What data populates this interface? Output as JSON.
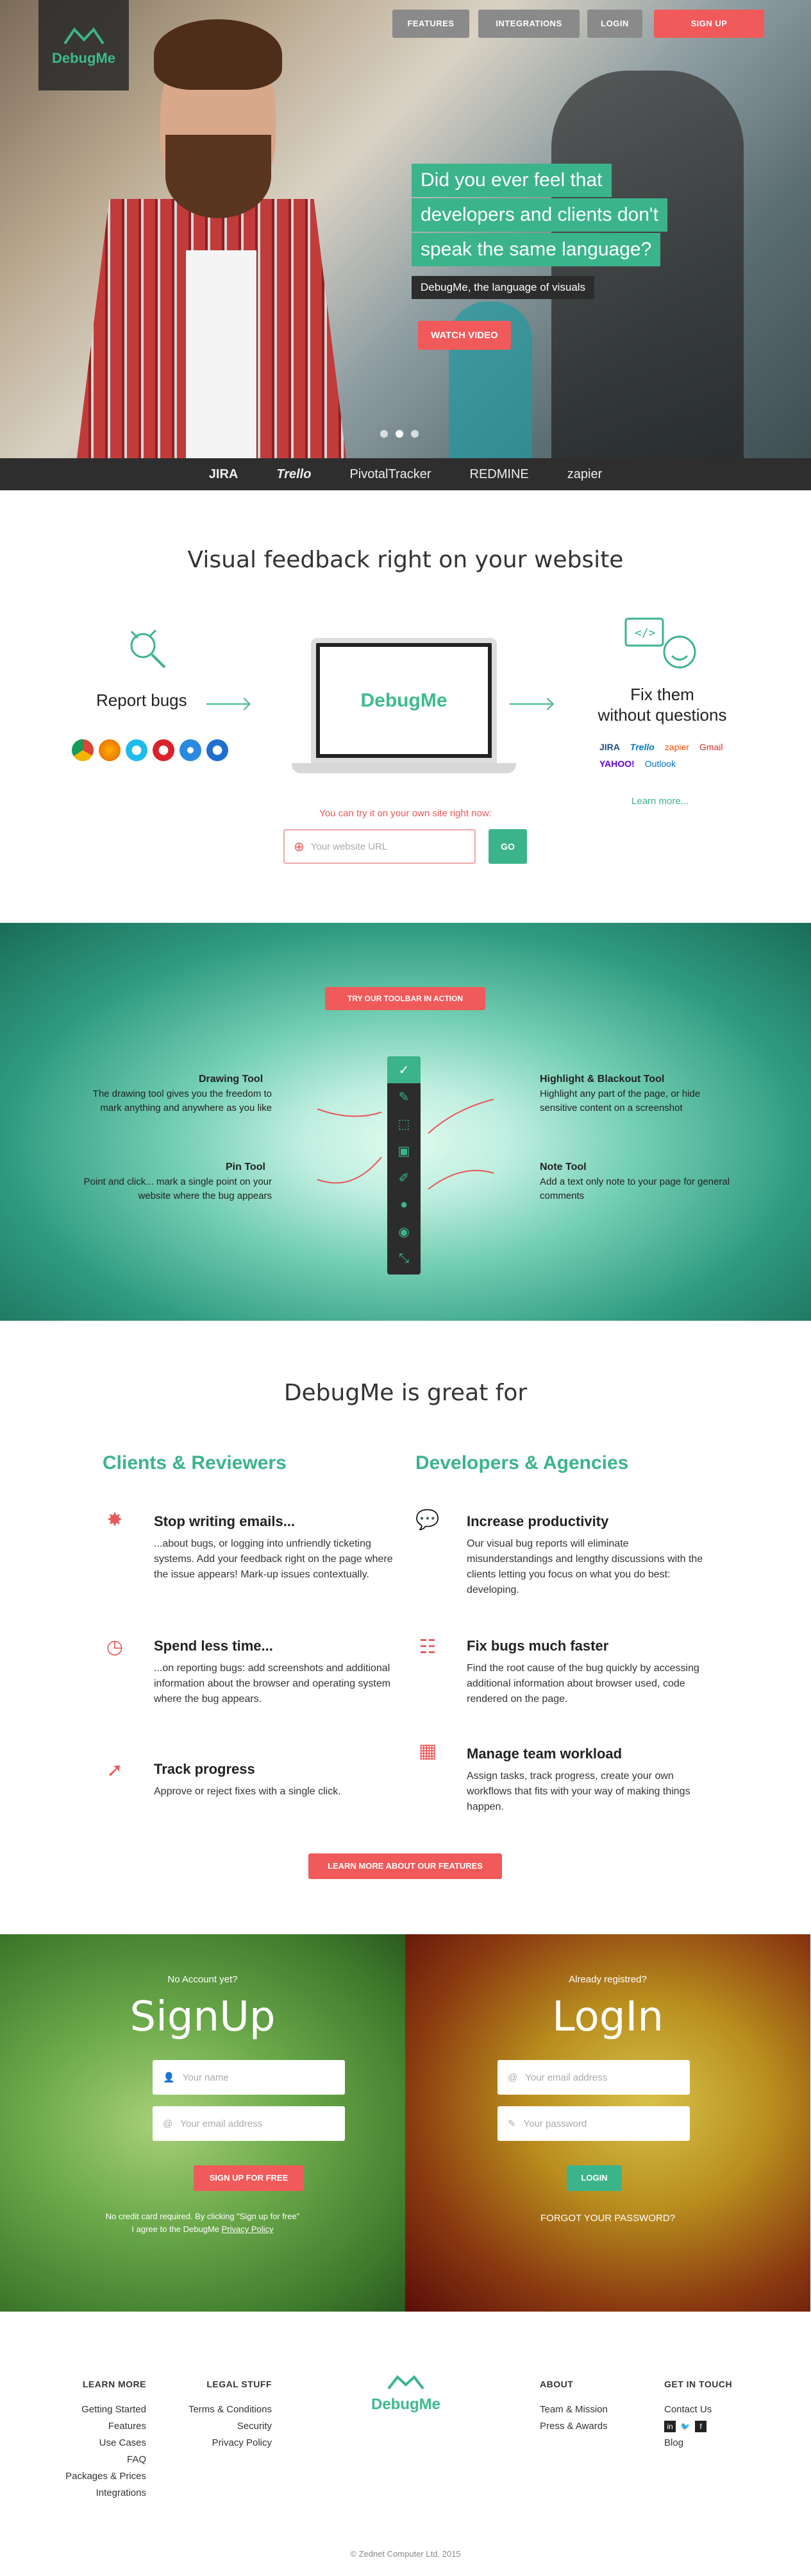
{
  "nav": {
    "logo": "DebugMe",
    "features": "FEATURES",
    "integrations": "INTEGRATIONS",
    "login": "LOGIN",
    "signup": "SIGN UP"
  },
  "hero": {
    "line1": "Did you ever feel that",
    "line2": "developers and clients don't",
    "line3": "speak the same language?",
    "subtitle": "DebugMe, the language of visuals",
    "watch_video": "WATCH VIDEO"
  },
  "partners": [
    "JIRA",
    "Trello",
    "PivotalTracker",
    "REDMINE",
    "zapier"
  ],
  "visual": {
    "title": "Visual feedback right on your website",
    "report_bugs": "Report bugs",
    "fix_line1": "Fix them",
    "fix_line2": "without questions",
    "tools": [
      "JIRA",
      "Trello",
      "zapier",
      "Gmail",
      "YAHOO!",
      "Outlook"
    ],
    "learn_more": "Learn more...",
    "try_text": "You can try it on your own site right now:",
    "url_placeholder": "Your website URL",
    "go": "GO",
    "laptop_logo": "DebugMe"
  },
  "toolbar": {
    "button": "TRY OUR TOOLBAR IN ACTION",
    "drawing_title": "Drawing Tool",
    "drawing_desc1": "The drawing tool gives you the freedom to",
    "drawing_desc2": "mark anything and anywhere as you like",
    "pin_title": "Pin Tool",
    "pin_desc1": "Point and click... mark a single point on your",
    "pin_desc2": "website where the bug appears",
    "highlight_title": "Highlight & Blackout Tool",
    "highlight_desc1": "Highlight any part of the page, or hide",
    "highlight_desc2": "sensitive content on a screenshot",
    "note_title": "Note Tool",
    "note_desc1": "Add a text only note to your page for general",
    "note_desc2": "comments"
  },
  "greatfor": {
    "title": "DebugMe is great for",
    "left_header": "Clients & Reviewers",
    "right_header": "Developers & Agencies",
    "f1_title": "Stop writing emails...",
    "f1_desc": "...about bugs, or logging into unfriendly ticketing systems. Add your feedback right on the page where the issue appears! Mark-up issues contextually.",
    "f2_title": "Spend less time...",
    "f2_desc": "...on reporting bugs: add screenshots and additional information about the browser and operating system where the bug appears.",
    "f3_title": "Track progress",
    "f3_desc": "Approve or reject fixes with a single click.",
    "f4_title": "Increase productivity",
    "f4_desc": "Our visual bug reports will eliminate misunderstandings and lengthy discussions with the clients letting you focus on what you do best: developing.",
    "f5_title": "Fix bugs much faster",
    "f5_desc": "Find the root cause of the bug quickly by accessing additional information about browser used, code rendered on the page.",
    "f6_title": "Manage team workload",
    "f6_desc": "Assign tasks, track progress, create your own workflows that fits with your way of making things happen.",
    "learn_button": "LEARN MORE ABOUT OUR FEATURES"
  },
  "auth": {
    "no_account": "No Account yet?",
    "signup_title": "SignUp",
    "name_placeholder": "Your name",
    "email_placeholder": "Your email address",
    "signup_button": "SIGN UP FOR FREE",
    "no_credit": "No credit card required. By clicking \"Sign up for free\"",
    "agree": "I agree to the DebugMe",
    "privacy": "Privacy Policy",
    "registered": "Already registred?",
    "login_title": "LogIn",
    "login_email_placeholder": "Your email address",
    "password_placeholder": "Your password",
    "login_button": "LOGIN",
    "forgot": "FORGOT YOUR PASSWORD?"
  },
  "footer": {
    "learn_more": "LEARN MORE",
    "learn_items": [
      "Getting Started",
      "Features",
      "Use Cases",
      "FAQ",
      "Packages & Prices",
      "Integrations"
    ],
    "legal": "LEGAL STUFF",
    "legal_items": [
      "Terms & Conditions",
      "Security",
      "Privacy Policy"
    ],
    "logo": "DebugMe",
    "about": "ABOUT",
    "about_items": [
      "Team & Mission",
      "Press & Awards"
    ],
    "touch": "GET IN TOUCH",
    "contact": "Contact Us",
    "blog": "Blog",
    "copyright": "© Zednet Computer Ltd. 2015"
  },
  "colors": {
    "accent": "#3bb48b",
    "cta": "#f05a5a",
    "dark": "#2e2e2e"
  }
}
